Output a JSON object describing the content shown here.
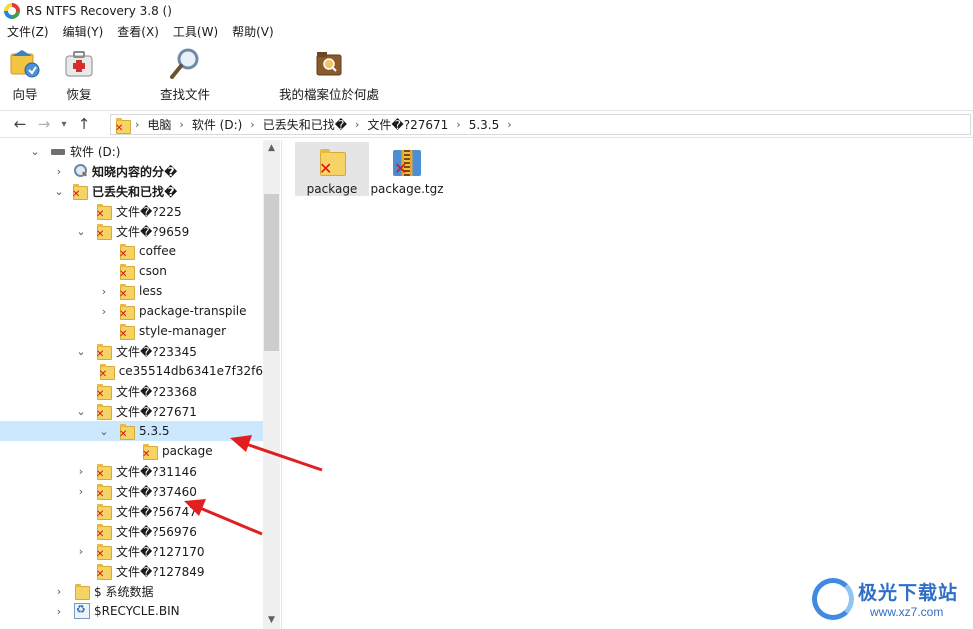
{
  "window": {
    "title": "RS NTFS Recovery 3.8 ()"
  },
  "menu": [
    "文件(Z)",
    "编辑(Y)",
    "查看(X)",
    "工具(W)",
    "帮助(V)"
  ],
  "toolbar": {
    "wizard": "向导",
    "recover": "恢复",
    "find_file": "查找文件",
    "where_file": "我的檔案位於何處"
  },
  "address": {
    "crumbs": [
      "电脑",
      "软件 (D:)",
      "已丢失和已找�",
      "文件�?27671",
      "5.3.5"
    ]
  },
  "tree": [
    {
      "label": "软件 (D:)",
      "chevron": "down",
      "icon": "drive-icon"
    },
    {
      "label": "知晓内容的分�",
      "chevron": "right",
      "icon": "search-icon",
      "bold": true
    },
    {
      "label": "已丢失和已找�",
      "chevron": "down",
      "icon": "lost-folder-icon",
      "bold": true
    },
    {
      "label": "文件�?225",
      "chevron": "",
      "icon": "lost-folder-icon"
    },
    {
      "label": "文件�?9659",
      "chevron": "down",
      "icon": "lost-folder-icon"
    },
    {
      "label": "coffee",
      "chevron": "",
      "icon": "lost-folder-icon"
    },
    {
      "label": "cson",
      "chevron": "",
      "icon": "lost-folder-icon"
    },
    {
      "label": "less",
      "chevron": "right",
      "icon": "lost-folder-icon"
    },
    {
      "label": "package-transpile",
      "chevron": "right",
      "icon": "lost-folder-icon"
    },
    {
      "label": "style-manager",
      "chevron": "",
      "icon": "lost-folder-icon"
    },
    {
      "label": "文件�?23345",
      "chevron": "down",
      "icon": "lost-folder-icon"
    },
    {
      "label": "ce35514db6341e7f32f6",
      "chevron": "",
      "icon": "lost-folder-icon"
    },
    {
      "label": "文件�?23368",
      "chevron": "",
      "icon": "lost-folder-icon"
    },
    {
      "label": "文件�?27671",
      "chevron": "down",
      "icon": "lost-folder-icon"
    },
    {
      "label": "5.3.5",
      "chevron": "down",
      "icon": "lost-folder-icon",
      "selected": true
    },
    {
      "label": "package",
      "chevron": "",
      "icon": "lost-folder-icon"
    },
    {
      "label": "文件�?31146",
      "chevron": "right",
      "icon": "lost-folder-icon"
    },
    {
      "label": "文件�?37460",
      "chevron": "right",
      "icon": "lost-folder-icon"
    },
    {
      "label": "文件�?56747",
      "chevron": "",
      "icon": "lost-folder-icon"
    },
    {
      "label": "文件�?56976",
      "chevron": "",
      "icon": "lost-folder-icon"
    },
    {
      "label": "文件�?127170",
      "chevron": "right",
      "icon": "lost-folder-icon"
    },
    {
      "label": "文件�?127849",
      "chevron": "",
      "icon": "lost-folder-icon"
    },
    {
      "label": "$ 系统数据",
      "chevron": "right",
      "icon": "folder-icon"
    },
    {
      "label": "$RECYCLE.BIN",
      "chevron": "right",
      "icon": "recycle-bin-icon"
    }
  ],
  "files": [
    {
      "label": "package",
      "type": "folder",
      "selected": true
    },
    {
      "label": "package.tgz",
      "type": "archive",
      "selected": false
    }
  ],
  "watermark": {
    "title": "极光下载站",
    "url": "www.xz7.com"
  },
  "colors": {
    "selection": "#cce8ff",
    "arrow": "#e02020",
    "brand": "#2f6fc7"
  }
}
